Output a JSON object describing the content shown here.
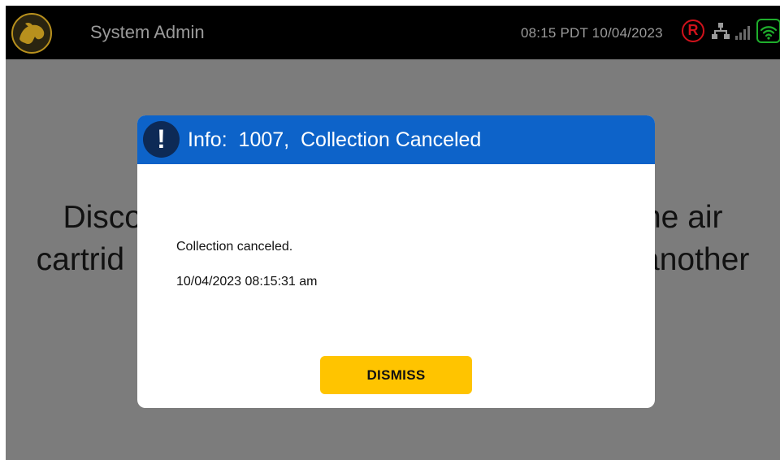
{
  "header": {
    "user_label": "System Admin",
    "datetime": "08:15 PDT 10/04/2023",
    "status_icons": [
      "registered-icon",
      "network-icon",
      "signal-bars-icon",
      "wifi-icon"
    ],
    "registered_mark": "R",
    "logo_icon": "dog-logo-icon"
  },
  "background": {
    "line1_left": "Disco",
    "line1_right": "he air",
    "line2_left": "cartrid",
    "line2_right": "another"
  },
  "dialog": {
    "icon": "exclamation-icon",
    "icon_glyph": "!",
    "title": "Info:  1007,  Collection Canceled",
    "message": "Collection canceled.",
    "timestamp": "10/04/2023 08:15:31 am",
    "dismiss_label": "DISMISS"
  },
  "colors": {
    "header_bg": "#000000",
    "overlay": "#7c7c7c",
    "dialog_header": "#0d63c9",
    "dismiss_button": "#ffc400",
    "registered": "#d0121b",
    "wifi": "#1fae2c"
  }
}
